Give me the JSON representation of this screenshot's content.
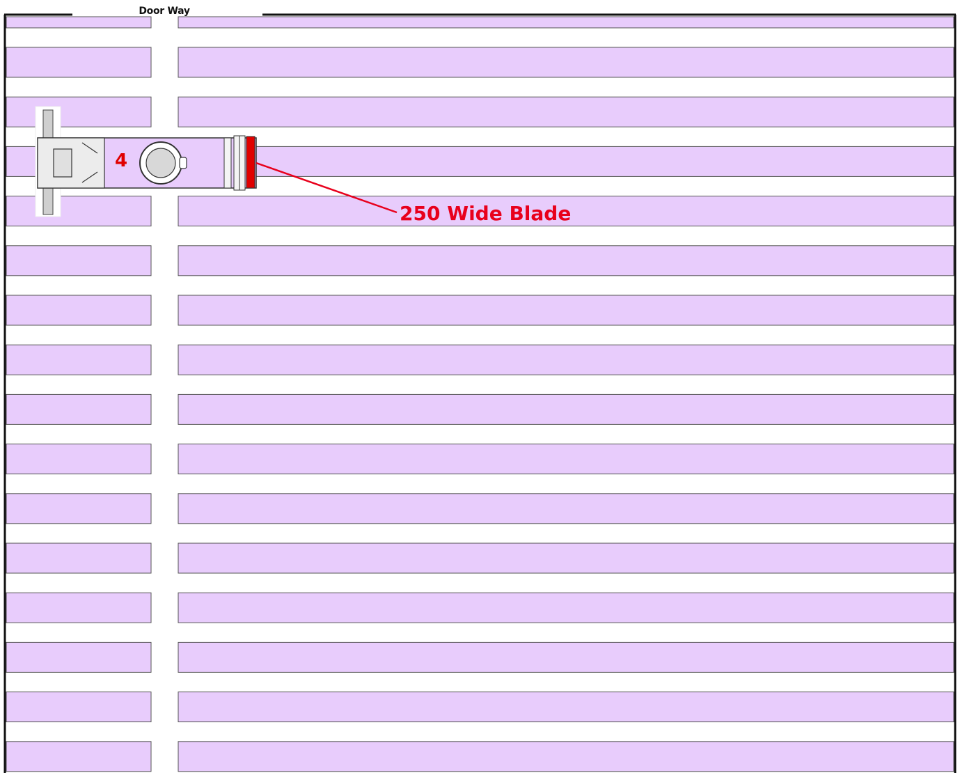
{
  "doorway": {
    "label": "Door Way"
  },
  "floor": {
    "strip_count": 16,
    "strip_color": "#e8ccfc",
    "border_color": "#111111"
  },
  "machine": {
    "number_label": "4",
    "accent_color": "#e00000"
  },
  "callout": {
    "label": "250 Wide Blade",
    "color": "#e8001c"
  }
}
